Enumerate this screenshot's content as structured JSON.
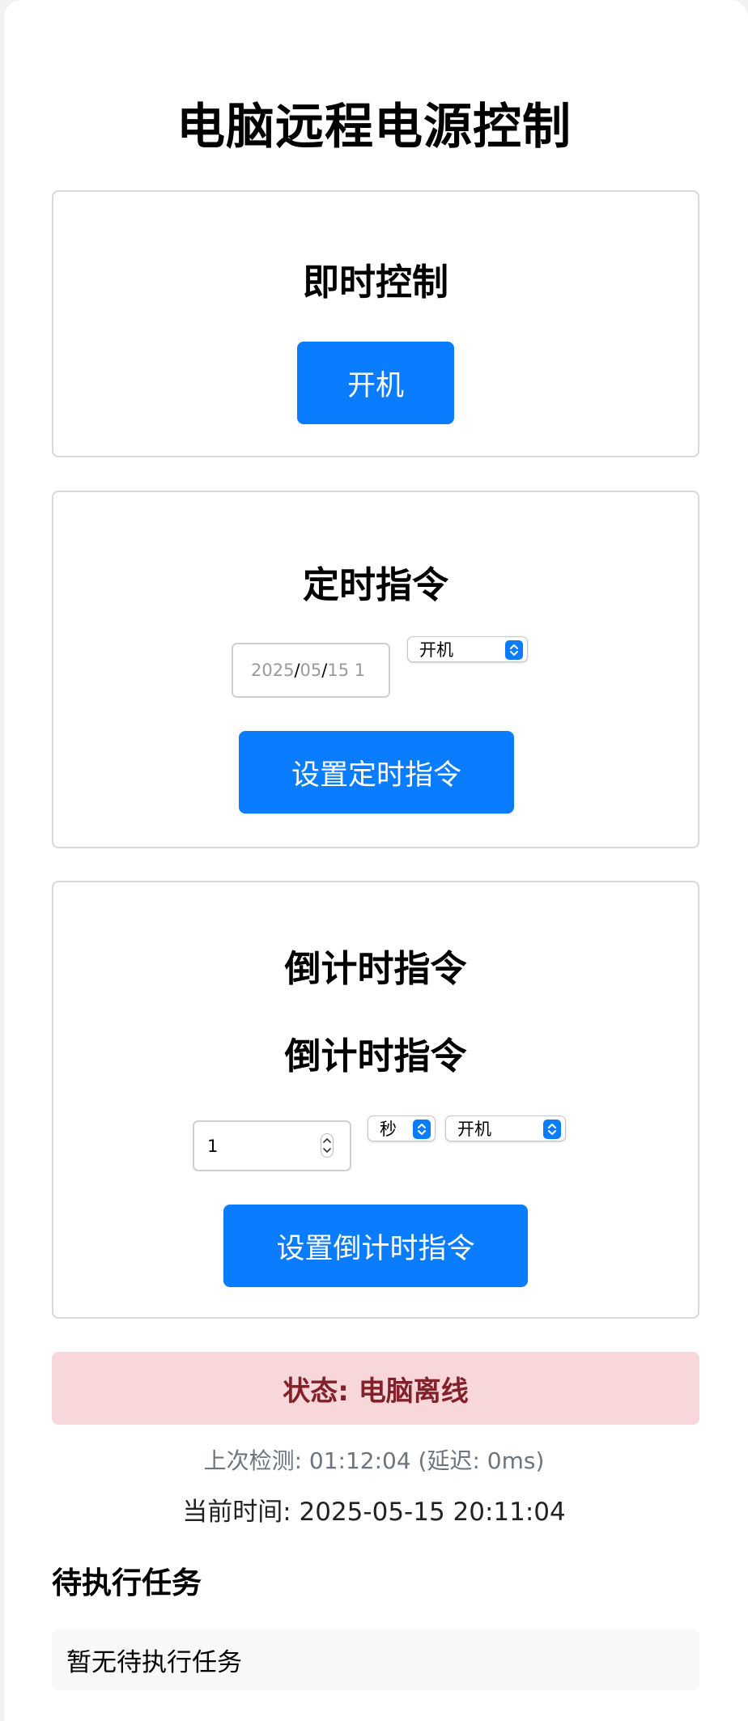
{
  "page": {
    "title": "电脑远程电源控制"
  },
  "instant": {
    "title": "即时控制",
    "button_label": "开机"
  },
  "scheduled": {
    "title": "定时指令",
    "datetime_year": "2025",
    "datetime_sep1": "/",
    "datetime_month": "05",
    "datetime_sep2": "/",
    "datetime_day": "15 1",
    "action_selected": "开机",
    "button_label": "设置定时指令"
  },
  "countdown": {
    "title": "倒计时指令",
    "subtitle": "倒计时指令",
    "amount_value": "1",
    "unit_selected": "秒",
    "action_selected": "开机",
    "button_label": "设置倒计时指令"
  },
  "status": {
    "text": "状态: 电脑离线",
    "last_check": "上次检测: 01:12:04 (延迟: 0ms)",
    "current_time": "当前时间: 2025-05-15 20:11:04"
  },
  "tasks": {
    "title": "待执行任务",
    "empty_text": "暂无待执行任务"
  },
  "colors": {
    "primary_button": "#0a7cff",
    "status_bg": "#f8d7da",
    "status_text": "#842029"
  },
  "icons": {
    "select_arrow": "updown-chevron-icon",
    "spinner": "number-spinner-icon"
  }
}
